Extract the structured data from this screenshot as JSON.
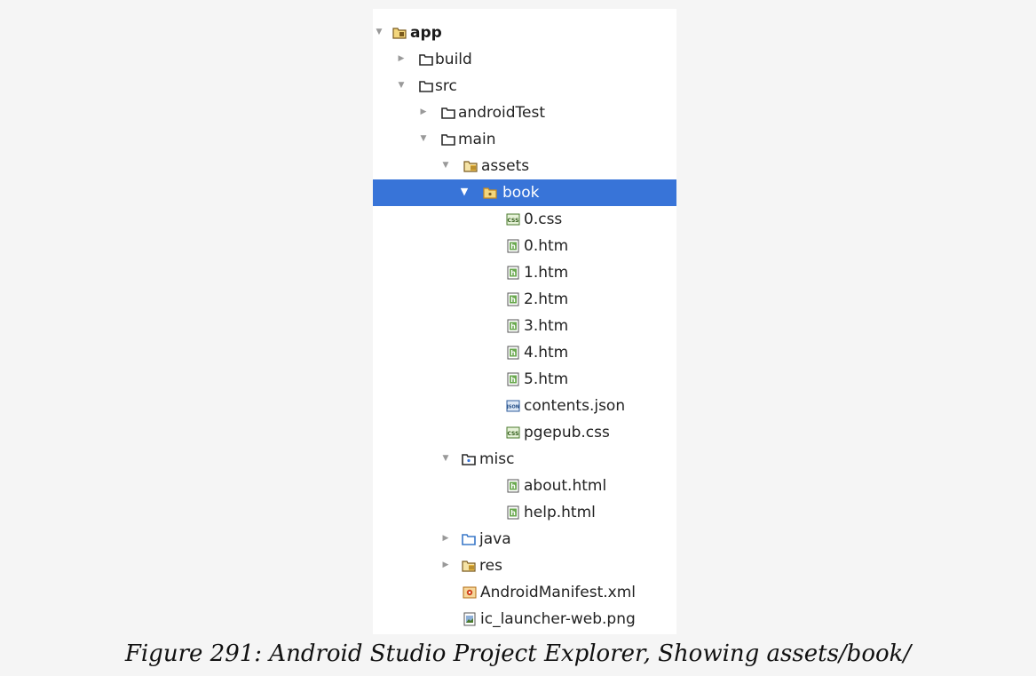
{
  "colors": {
    "selection": "#3874d8",
    "page_background": "#f5f5f5",
    "panel_background": "#ffffff",
    "folder_brown": "#7a5a1e",
    "folder_blue": "#5b8fd0",
    "resource_folder_yellow": "#e8b43a",
    "html_file_green": "#6aa84f"
  },
  "tree": [
    {
      "label": "app",
      "arrow": "expanded",
      "icon": "module-folder-icon"
    },
    {
      "label": "build",
      "arrow": "collapsed",
      "icon": "folder-icon"
    },
    {
      "label": "src",
      "arrow": "expanded",
      "icon": "folder-icon"
    },
    {
      "label": "androidTest",
      "arrow": "collapsed",
      "icon": "folder-icon"
    },
    {
      "label": "main",
      "arrow": "expanded",
      "icon": "folder-icon"
    },
    {
      "label": "assets",
      "arrow": "expanded",
      "icon": "assets-folder-icon"
    },
    {
      "label": "book",
      "arrow": "expanded",
      "icon": "package-folder-icon",
      "selected": true
    },
    {
      "label": "0.css",
      "icon": "css-file-icon"
    },
    {
      "label": "0.htm",
      "icon": "html-file-icon"
    },
    {
      "label": "1.htm",
      "icon": "html-file-icon"
    },
    {
      "label": "2.htm",
      "icon": "html-file-icon"
    },
    {
      "label": "3.htm",
      "icon": "html-file-icon"
    },
    {
      "label": "4.htm",
      "icon": "html-file-icon"
    },
    {
      "label": "5.htm",
      "icon": "html-file-icon"
    },
    {
      "label": "contents.json",
      "icon": "json-file-icon"
    },
    {
      "label": "pgepub.css",
      "icon": "css-file-icon"
    },
    {
      "label": "misc",
      "arrow": "expanded",
      "icon": "package-folder-icon"
    },
    {
      "label": "about.html",
      "icon": "html-file-icon"
    },
    {
      "label": "help.html",
      "icon": "html-file-icon"
    },
    {
      "label": "java",
      "arrow": "collapsed",
      "icon": "source-folder-icon"
    },
    {
      "label": "res",
      "arrow": "collapsed",
      "icon": "resource-folder-icon"
    },
    {
      "label": "AndroidManifest.xml",
      "icon": "xml-manifest-icon"
    },
    {
      "label": "ic_launcher-web.png",
      "icon": "image-file-icon"
    }
  ],
  "caption": "Figure 291: Android Studio Project Explorer, Showing assets/book/"
}
